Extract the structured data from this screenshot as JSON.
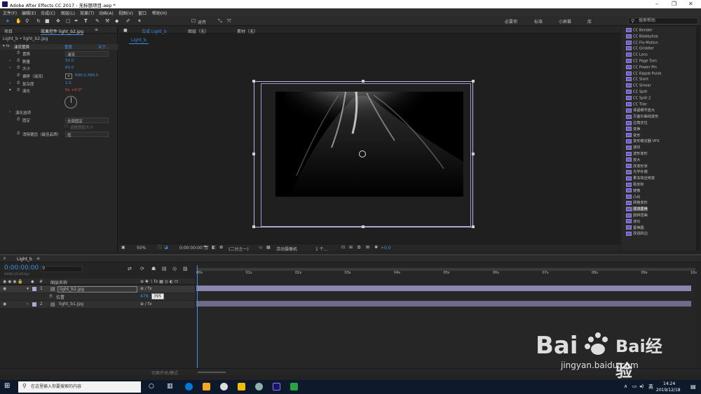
{
  "app": {
    "title": "Adobe After Effects CC 2017 - 无标题项目.aep *"
  },
  "menu": [
    "文件(F)",
    "编辑(E)",
    "合成(C)",
    "图层(L)",
    "效果(T)",
    "动画(A)",
    "视图(V)",
    "窗口",
    "帮助(H)"
  ],
  "toolbar": {
    "align_label": "对齐",
    "workspaces": [
      "必要项",
      "标准",
      "小屏幕",
      "库"
    ],
    "search_placeholder": "搜索帮助"
  },
  "left_panel": {
    "tabs": [
      "项目",
      "效果控件 light_b2.jpg"
    ],
    "path": "Light_b • light_b2.jpg",
    "fx_name": "湍流置换",
    "fx_reset": "重置",
    "fx_about": "关于...",
    "props": [
      {
        "label": "置换",
        "value": "湍流"
      },
      {
        "label": "数量",
        "value": "50.0"
      },
      {
        "label": "大小",
        "value": "65.0"
      },
      {
        "label": "偏移（湍流）",
        "value": "690.0,399.5"
      },
      {
        "label": "复杂度",
        "value": "1.0"
      },
      {
        "label": "演化",
        "value": "0x +0.0°"
      },
      {
        "label": "演化选项",
        "value": ""
      },
      {
        "label": "固定",
        "value": "全部固定"
      },
      {
        "label": "调整图层大小",
        "value": ""
      },
      {
        "label": "消除锯齿（最佳品质）",
        "value": "低"
      }
    ]
  },
  "comp": {
    "tabs": [
      "合成 Light_b",
      "图层（无）",
      "素材（无）"
    ],
    "breadcrumb": "Light_b",
    "zoom": "50%",
    "timecode": "0:00:00:00",
    "resolution": "(二分之一)",
    "camera": "活动摄像机",
    "views": "1 个...",
    "exposure": "+0.0"
  },
  "effects_list": [
    "CC Bender",
    "CC Blobbylize",
    "CC Flo Motion",
    "CC Griddler",
    "CC Lens",
    "CC Page Turn",
    "CC Power Pin",
    "CC Ripple Pulse",
    "CC Slant",
    "CC Smear",
    "CC Split",
    "CC Split 2",
    "CC Tiler",
    "保留细节放大",
    "贝塞尔曲线变形",
    "边角定位",
    "变换",
    "变形",
    "变形稳定器 VFX",
    "波纹",
    "波形变形",
    "放大",
    "改变形状",
    "光学补偿",
    "果冻效应修复",
    "极坐标",
    "镜像",
    "凸出",
    "网格变形",
    "湍流置换",
    "旋转扭曲",
    "液化",
    "置换图",
    "改进的边"
  ],
  "timeline": {
    "tab": "Light_b",
    "timecode": "0:00:00:00",
    "fps": "00000 (25.00 fps)",
    "col_header": "图层名称",
    "layers": [
      {
        "num": "1",
        "name": "light_b2.jpg"
      },
      {
        "num": "2",
        "name": "light_b1.jpg"
      }
    ],
    "sub_prop": {
      "label": "位置",
      "value_x": "479.",
      "value_y": "395"
    },
    "ruler": [
      "00s",
      "01s",
      "02s",
      "03s",
      "04s",
      "05s",
      "06s",
      "07s",
      "08s",
      "09s",
      "10s"
    ],
    "footer": "切换开关/模式"
  },
  "taskbar": {
    "search_placeholder": "在这里输入你要搜索的内容",
    "lang": "英",
    "time": "14:24",
    "date": "2019/12/18"
  },
  "watermark": {
    "brand": "Bai经验",
    "url": "jingyan.baidu.com"
  }
}
